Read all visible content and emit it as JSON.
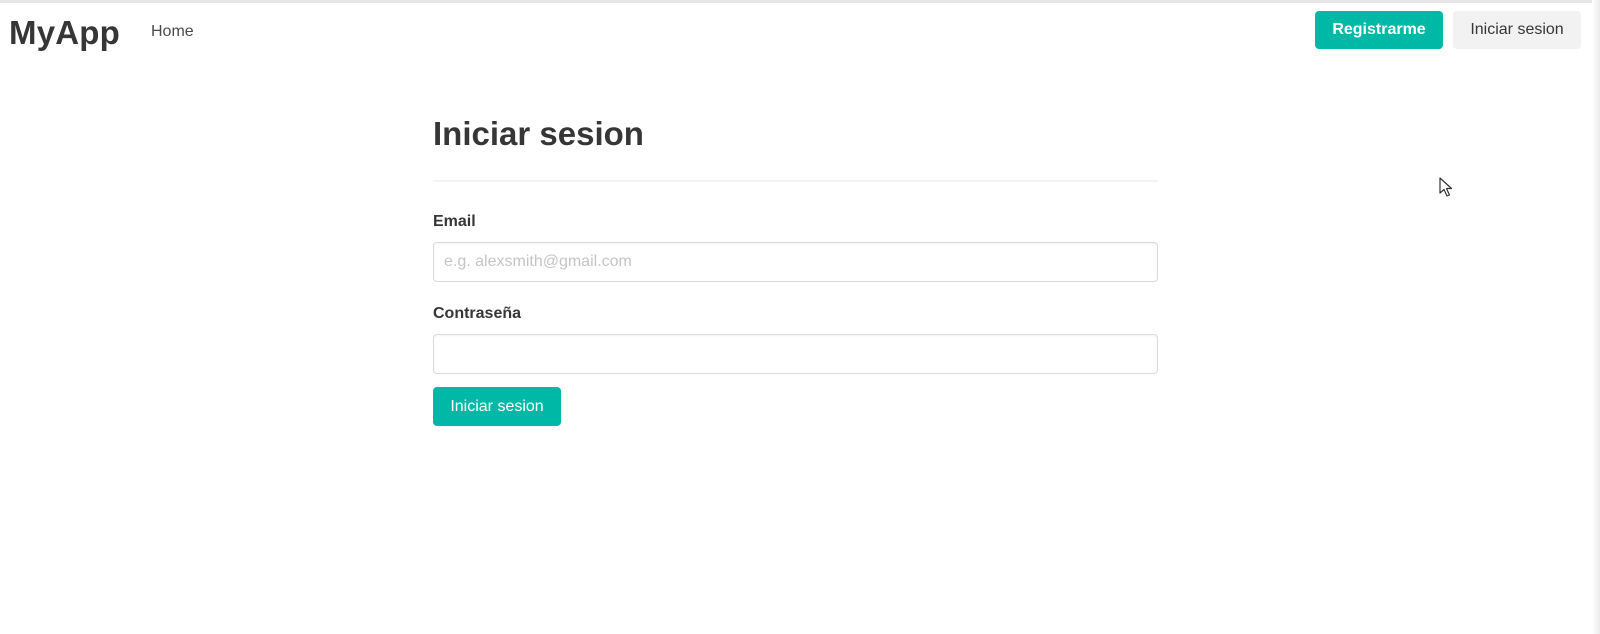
{
  "navbar": {
    "brand": "MyApp",
    "home_link": "Home",
    "register_button": "Registrarme",
    "login_button": "Iniciar sesion"
  },
  "login_form": {
    "title": "Iniciar sesion",
    "email_label": "Email",
    "email_placeholder": "e.g. alexsmith@gmail.com",
    "email_value": "",
    "password_label": "Contraseña",
    "password_value": "",
    "submit_button": "Iniciar sesion"
  },
  "colors": {
    "primary": "#00b8a6",
    "light_button": "#f2f2f2",
    "text": "#363636"
  },
  "icons": {
    "cursor": "mouse-pointer-icon"
  }
}
